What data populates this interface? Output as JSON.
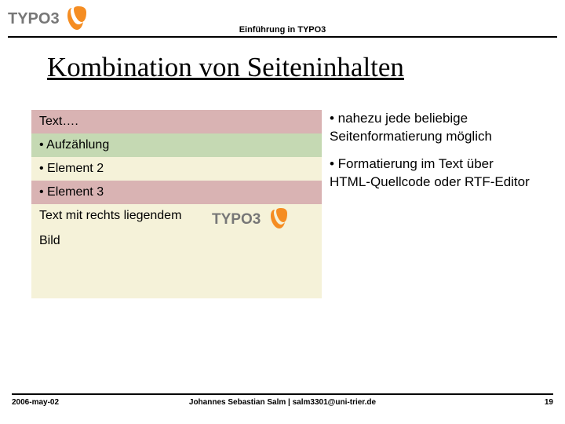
{
  "header": {
    "subtitle": "Einführung in TYPO3"
  },
  "title": "Kombination von Seiteninhalten",
  "left": {
    "r0": "Text….",
    "r1": "• Aufzählung",
    "r2": "• Element 2",
    "r3": "• Element 3",
    "block_line1": "Text mit rechts liegendem",
    "block_line2": "Bild"
  },
  "right": {
    "p1": "• nahezu jede beliebige Seitenformatierung möglich",
    "p2": "• Formatierung im Text über HTML-Quellcode oder RTF-Editor"
  },
  "footer": {
    "left": "2006-may-02",
    "center": "Johannes Sebastian Salm | salm3301@uni-trier.de",
    "right": "19"
  },
  "logo_text": "TYPO3"
}
